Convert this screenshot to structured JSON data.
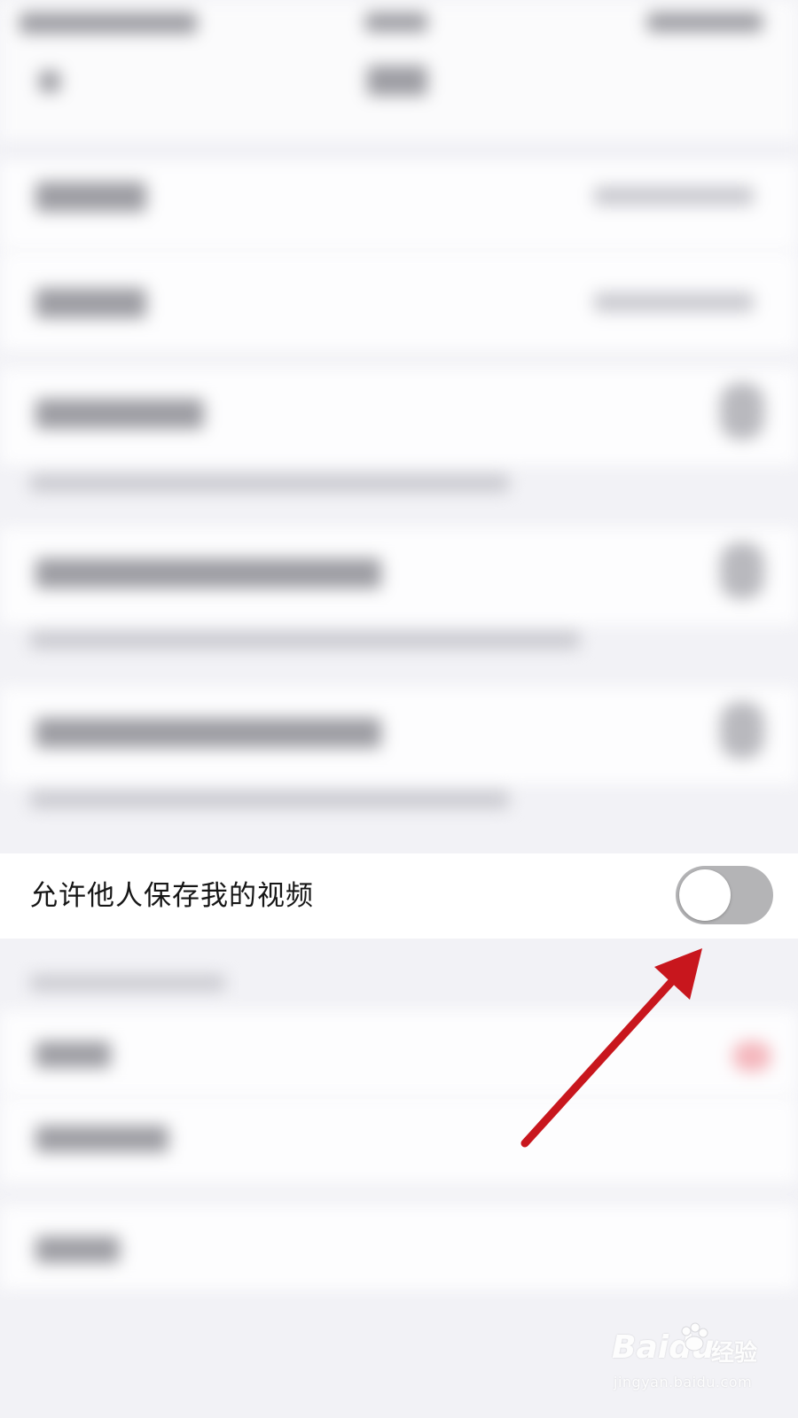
{
  "setting_row": {
    "label": "允许他人保存我的视频",
    "toggle_state": "off"
  },
  "colors": {
    "background": "#f2f2f6",
    "row_background": "#ffffff",
    "toggle_off_track": "#b4b4b6",
    "arrow": "#c8161d"
  },
  "watermark": {
    "brand": "Bai",
    "brand_suffix": "du",
    "product": "经验",
    "url": "jingyan.baidu.com"
  }
}
